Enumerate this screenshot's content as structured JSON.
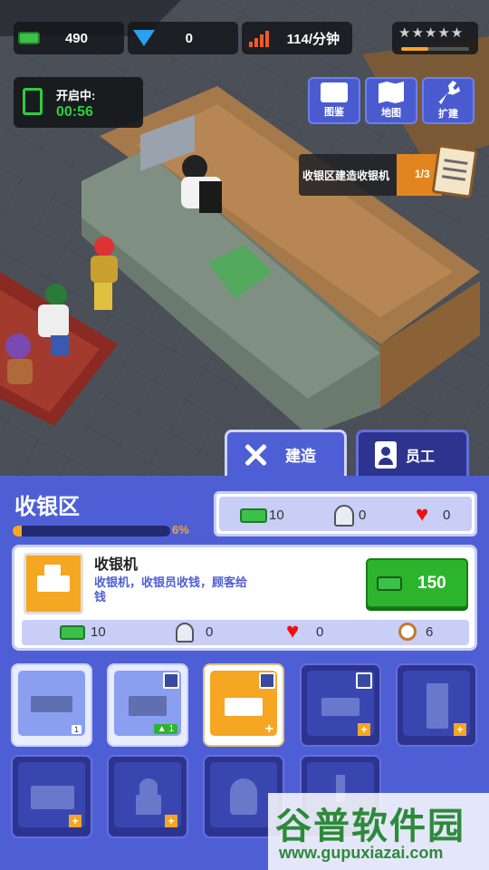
{
  "topbar": {
    "cash": "490",
    "gems": "0",
    "income": "114/分钟",
    "rating_stars": 0
  },
  "timer": {
    "label": "开启中:",
    "value": "00:56"
  },
  "menu": {
    "catalog": "图鉴",
    "map": "地图",
    "expand": "扩建"
  },
  "quest": {
    "text": "收银区建造收银机",
    "progress": "1/3"
  },
  "tabs": {
    "build": "建造",
    "staff": "员工"
  },
  "zone": {
    "title": "收银区",
    "progress_label": "6%",
    "progress": 0.06,
    "stats": {
      "cash": "10",
      "ghost": "0",
      "heart": "0"
    }
  },
  "item": {
    "name": "收银机",
    "desc": "收银机，收银员收钱，顾客给钱",
    "price": "150",
    "stats": {
      "cash": "10",
      "ghost": "0",
      "heart": "0",
      "time": "6"
    }
  },
  "cards": [
    {
      "badge": "1"
    },
    {
      "badge": "1"
    },
    {
      "badge": ""
    },
    {
      "badge": ""
    },
    {
      "badge": ""
    },
    {
      "badge": ""
    },
    {
      "badge": ""
    },
    {
      "badge": ""
    },
    {
      "badge": ""
    }
  ],
  "watermark": {
    "brand": "谷普软件园",
    "url": "www.gupuxiazai.com"
  },
  "colors": {
    "panel_blue": "#4e5fd6",
    "accent_orange": "#f5a623",
    "buy_green": "#2cb52c"
  }
}
